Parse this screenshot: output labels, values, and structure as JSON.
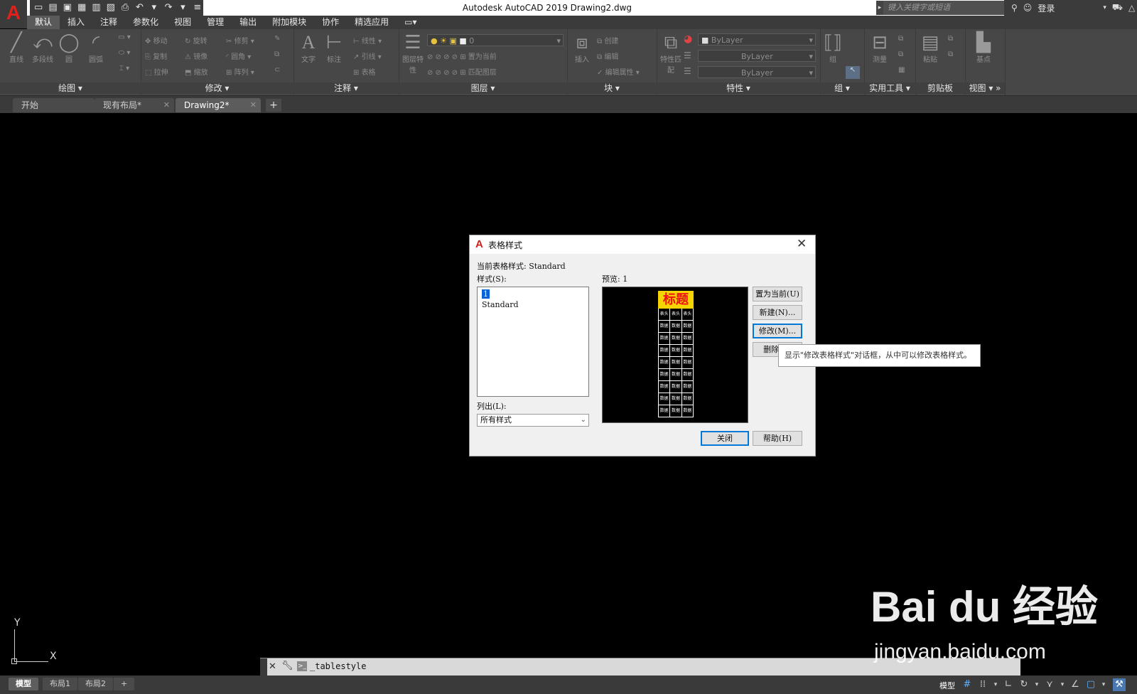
{
  "window": {
    "title": "Autodesk AutoCAD 2019    Drawing2.dwg",
    "app_letter": "A",
    "search_placeholder": "键入关键字或短语",
    "login_label": "登录"
  },
  "menu_tabs": [
    "默认",
    "插入",
    "注释",
    "参数化",
    "视图",
    "管理",
    "输出",
    "附加模块",
    "协作",
    "精选应用"
  ],
  "ribbon": {
    "panels": {
      "draw": "绘图",
      "modify": "修改",
      "annotate": "注释",
      "layers": "图层",
      "block": "块",
      "properties": "特性",
      "group": "组",
      "utilities": "实用工具",
      "clipboard": "剪贴板",
      "view": "视图"
    },
    "draw_tools": [
      "直线",
      "多段线",
      "圆",
      "圆弧"
    ],
    "modify_tools": [
      "移动",
      "旋转",
      "修剪",
      "复制",
      "镜像",
      "圆角",
      "拉伸",
      "缩放",
      "阵列"
    ],
    "annotate_tools": [
      "文字",
      "标注",
      "线性",
      "引线",
      "表格"
    ],
    "layer_tools": [
      "图层特性",
      "置为当前",
      "匹配图层"
    ],
    "layer_value": "0",
    "block_tools": [
      "插入",
      "创建",
      "编辑",
      "编辑属性"
    ],
    "properties_tools": [
      "特性匹配"
    ],
    "properties_fields": [
      "ByLayer",
      "ByLayer",
      "ByLayer"
    ],
    "group_tools": [
      "组"
    ],
    "utilities_tools": [
      "测量"
    ],
    "clipboard_tools": [
      "粘贴"
    ],
    "view_tools": [
      "基点"
    ]
  },
  "file_tabs": [
    {
      "label": "开始",
      "closable": false,
      "active": false
    },
    {
      "label": "现有布局*",
      "closable": true,
      "active": false
    },
    {
      "label": "Drawing2*",
      "closable": true,
      "active": true
    }
  ],
  "ucs": {
    "y_label": "Y",
    "x_label": "X"
  },
  "dialog": {
    "title": "表格样式",
    "current_style_label": "当前表格样式: Standard",
    "styles_label": "样式(S):",
    "styles": [
      {
        "name": "1",
        "selected": true
      },
      {
        "name": "Standard",
        "selected": false
      }
    ],
    "list_label": "列出(L):",
    "list_value": "所有样式",
    "preview_label": "预览: 1",
    "preview_title": "标题",
    "preview_header": [
      "表头",
      "表头",
      "表头"
    ],
    "preview_cell": "数据",
    "buttons": {
      "set_current": "置为当前(U)",
      "new": "新建(N)...",
      "modify": "修改(M)...",
      "delete": "删除(D)",
      "close": "关闭",
      "help": "帮助(H)"
    },
    "tooltip": "显示\"修改表格样式\"对话框，从中可以修改表格样式。"
  },
  "command_line": {
    "text": "_tablestyle"
  },
  "layout_tabs": [
    {
      "label": "模型",
      "active": true
    },
    {
      "label": "布局1",
      "active": false
    },
    {
      "label": "布局2",
      "active": false
    }
  ],
  "status": {
    "model_label": "模型"
  },
  "watermark": {
    "logo": "Bai du 经验",
    "url": "jingyan.baidu.com"
  },
  "colors": {
    "accent_blue": "#0a64d8",
    "autocad_red": "#e0201b",
    "preview_title_bg": "#f5d400",
    "preview_title_fg": "#ee1111"
  }
}
